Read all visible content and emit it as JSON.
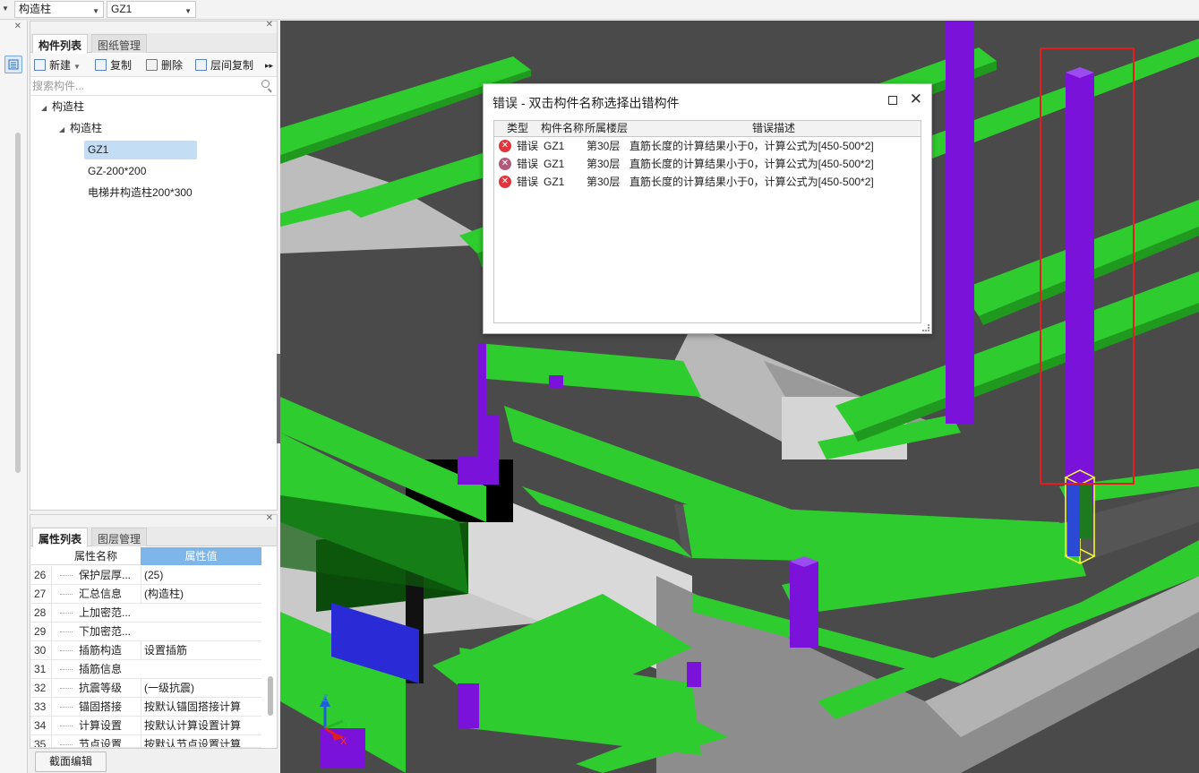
{
  "toolbar": {
    "combo1": "构造柱",
    "combo2": "GZ1"
  },
  "component_panel": {
    "tabs": [
      "构件列表",
      "图纸管理"
    ],
    "actions": {
      "new": "新建",
      "copy": "复制",
      "delete": "删除",
      "floor_copy": "层间复制",
      "more": "▸▸"
    },
    "search_placeholder": "搜索构件...",
    "tree": {
      "root": "构造柱",
      "child": "构造柱",
      "items": [
        "GZ1",
        "GZ-200*200",
        "电梯井构造柱200*300"
      ]
    }
  },
  "property_panel": {
    "tabs": [
      "属性列表",
      "图层管理"
    ],
    "headers": {
      "name": "属性名称",
      "value": "属性值"
    },
    "rows": [
      {
        "num": "26",
        "name": "保护层厚...",
        "value": "(25)"
      },
      {
        "num": "27",
        "name": "汇总信息",
        "value": "(构造柱)"
      },
      {
        "num": "28",
        "name": "上加密范...",
        "value": ""
      },
      {
        "num": "29",
        "name": "下加密范...",
        "value": ""
      },
      {
        "num": "30",
        "name": "插筋构造",
        "value": "设置插筋"
      },
      {
        "num": "31",
        "name": "插筋信息",
        "value": ""
      },
      {
        "num": "32",
        "name": "抗震等级",
        "value": "(一级抗震)"
      },
      {
        "num": "33",
        "name": "锚固搭接",
        "value": "按默认锚固搭接计算"
      },
      {
        "num": "34",
        "name": "计算设置",
        "value": "按默认计算设置计算"
      },
      {
        "num": "35",
        "name": "节点设置",
        "value": "按默认节点设置计算"
      }
    ],
    "bottom_button": "截面编辑"
  },
  "error_dialog": {
    "title": "错误 - 双击构件名称选择出错构件",
    "columns": [
      "类型",
      "构件名称",
      "所属楼层",
      "错误描述"
    ],
    "rows": [
      {
        "type": "错误",
        "name": "GZ1",
        "floor": "第30层",
        "desc": "直筋长度的计算结果小于0，计算公式为[450-500*2]",
        "icon_color": "#e0353b"
      },
      {
        "type": "错误",
        "name": "GZ1",
        "floor": "第30层",
        "desc": "直筋长度的计算结果小于0，计算公式为[450-500*2]",
        "icon_color": "#b05a7a"
      },
      {
        "type": "错误",
        "name": "GZ1",
        "floor": "第30层",
        "desc": "直筋长度的计算结果小于0，计算公式为[450-500*2]",
        "icon_color": "#e0353b"
      }
    ]
  },
  "axis": {
    "z": "Z",
    "y": "Y",
    "x": "X"
  },
  "colors": {
    "beam_green": "#2ecc2e",
    "column_purple": "#7b12d9",
    "selection_red": "#e41e1e",
    "highlight_yellow": "#ffff33",
    "slab_grey": "#c8c8c8"
  }
}
